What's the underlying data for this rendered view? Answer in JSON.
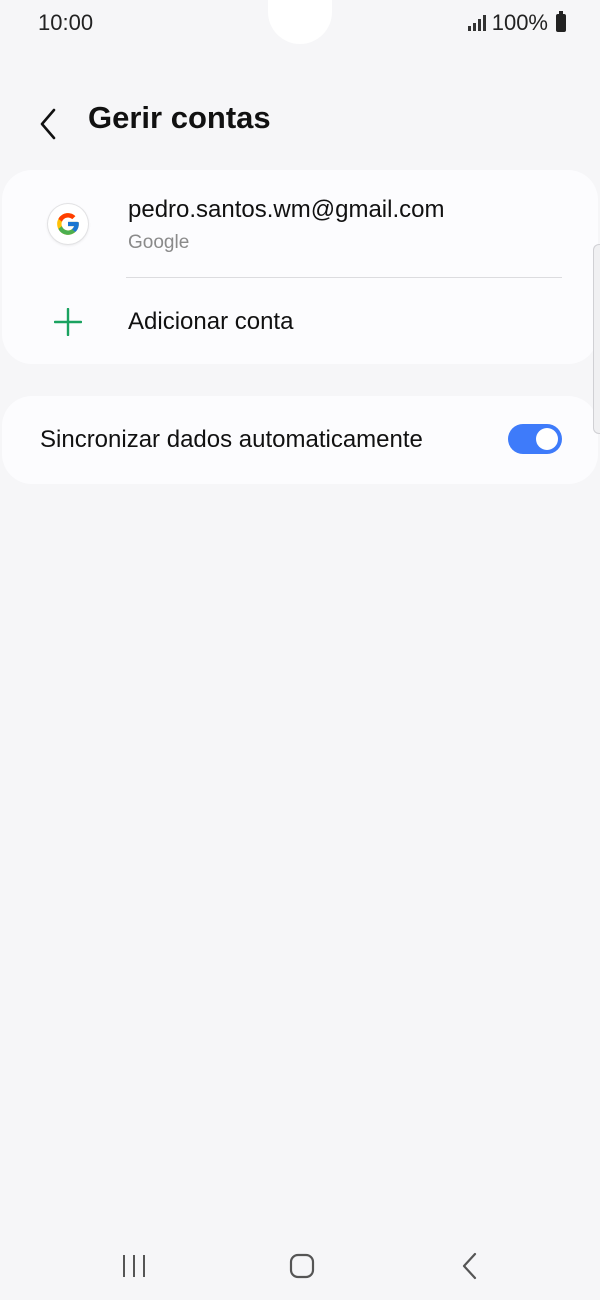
{
  "status_bar": {
    "time": "10:00",
    "battery": "100%"
  },
  "header": {
    "title": "Gerir contas"
  },
  "accounts": [
    {
      "email": "pedro.santos.wm@gmail.com",
      "type": "Google",
      "icon": "google-logo-icon"
    }
  ],
  "add_account": {
    "label": "Adicionar conta",
    "icon": "plus-icon",
    "color": "#1aa260"
  },
  "sync": {
    "label": "Sincronizar dados automaticamente",
    "enabled": true,
    "toggle_color": "#3e7bfa"
  },
  "nav": {
    "recent_icon": "recent-apps-icon",
    "home_icon": "home-icon",
    "back_icon": "back-icon"
  }
}
